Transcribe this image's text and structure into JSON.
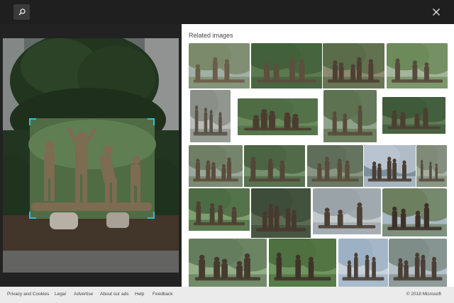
{
  "toolbar": {
    "search_icon": "search-icon",
    "close_icon": "close-icon"
  },
  "related": {
    "title": "Related images",
    "thumbnail_count": 24
  },
  "footer": {
    "links": [
      "Privacy and Cookies",
      "Legal",
      "Advertise",
      "About our ads",
      "Help",
      "Feedback"
    ],
    "copyright": "© 2018 Microsoft"
  },
  "colors": {
    "topbar": "#1f1f1f",
    "crop_accent": "#2cc4d4",
    "footer_bg": "#ebebeb",
    "panel_bg": "#ffffff"
  }
}
